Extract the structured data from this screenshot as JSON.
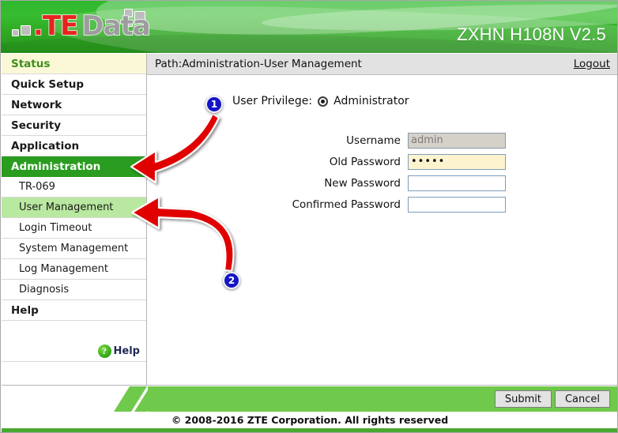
{
  "header": {
    "logo_text_part1": ".TE",
    "logo_text_part2": "Data",
    "model_title": "ZXHN H108N V2.5",
    "brand_green": "#2fa823",
    "logo_red": "#e8231f",
    "logo_grey": "#9d9d9d"
  },
  "sidebar": {
    "items": [
      {
        "label": "Status",
        "type": "status"
      },
      {
        "label": "Quick Setup",
        "type": "top"
      },
      {
        "label": "Network",
        "type": "top"
      },
      {
        "label": "Security",
        "type": "top"
      },
      {
        "label": "Application",
        "type": "top"
      },
      {
        "label": "Administration",
        "type": "active-parent"
      },
      {
        "label": "TR-069",
        "type": "sub"
      },
      {
        "label": "User Management",
        "type": "sub-selected"
      },
      {
        "label": "Login Timeout",
        "type": "sub"
      },
      {
        "label": "System Management",
        "type": "sub"
      },
      {
        "label": "Log Management",
        "type": "sub"
      },
      {
        "label": "Diagnosis",
        "type": "sub"
      },
      {
        "label": "Help",
        "type": "top"
      }
    ],
    "help_link": {
      "icon": "question-mark-circle-icon",
      "icon_glyph": "?",
      "label": "Help"
    }
  },
  "main": {
    "path": "Path:Administration-User Management",
    "logout": "Logout",
    "privilege_label": "User Privilege:",
    "privilege_option": "Administrator",
    "privilege_selected": true,
    "fields": [
      {
        "label": "Username",
        "value": "admin",
        "state": "disabled",
        "name": "username-field"
      },
      {
        "label": "Old Password",
        "value": "•••••",
        "state": "filled",
        "name": "old-password-field"
      },
      {
        "label": "New Password",
        "value": "",
        "state": "empty",
        "name": "new-password-field"
      },
      {
        "label": "Confirmed Password",
        "value": "",
        "state": "empty",
        "name": "confirmed-password-field"
      }
    ]
  },
  "footer": {
    "submit_label": "Submit",
    "cancel_label": "Cancel",
    "copyright": "© 2008-2016 ZTE Corporation. All rights reserved"
  },
  "annotations": {
    "callouts": [
      {
        "number": "1",
        "target": "Administration"
      },
      {
        "number": "2",
        "target": "User Management"
      }
    ],
    "arrow_color": "#e00000"
  }
}
